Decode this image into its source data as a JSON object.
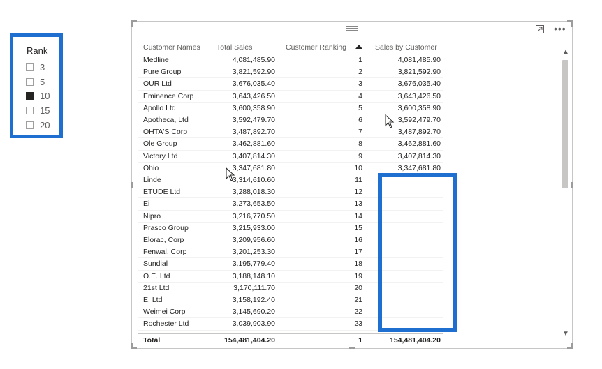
{
  "slicer": {
    "title": "Rank",
    "items": [
      {
        "label": "3",
        "checked": false
      },
      {
        "label": "5",
        "checked": false
      },
      {
        "label": "10",
        "checked": true
      },
      {
        "label": "15",
        "checked": false
      },
      {
        "label": "20",
        "checked": false
      }
    ]
  },
  "table": {
    "headers": {
      "customer_names": "Customer Names",
      "total_sales": "Total Sales",
      "customer_ranking": "Customer Ranking",
      "sales_by_customer": "Sales by Customer"
    },
    "rows": [
      {
        "name": "Medline",
        "sales": "4,081,485.90",
        "rank": "1",
        "sbc": "4,081,485.90"
      },
      {
        "name": "Pure Group",
        "sales": "3,821,592.90",
        "rank": "2",
        "sbc": "3,821,592.90"
      },
      {
        "name": "OUR Ltd",
        "sales": "3,676,035.40",
        "rank": "3",
        "sbc": "3,676,035.40"
      },
      {
        "name": "Eminence Corp",
        "sales": "3,643,426.50",
        "rank": "4",
        "sbc": "3,643,426.50"
      },
      {
        "name": "Apollo Ltd",
        "sales": "3,600,358.90",
        "rank": "5",
        "sbc": "3,600,358.90"
      },
      {
        "name": "Apotheca, Ltd",
        "sales": "3,592,479.70",
        "rank": "6",
        "sbc": "3,592,479.70"
      },
      {
        "name": "OHTA'S Corp",
        "sales": "3,487,892.70",
        "rank": "7",
        "sbc": "3,487,892.70"
      },
      {
        "name": "Ole Group",
        "sales": "3,462,881.60",
        "rank": "8",
        "sbc": "3,462,881.60"
      },
      {
        "name": "Victory Ltd",
        "sales": "3,407,814.30",
        "rank": "9",
        "sbc": "3,407,814.30"
      },
      {
        "name": "Ohio",
        "sales": "3,347,681.80",
        "rank": "10",
        "sbc": "3,347,681.80"
      },
      {
        "name": "Linde",
        "sales": "3,314,610.60",
        "rank": "11",
        "sbc": ""
      },
      {
        "name": "ETUDE Ltd",
        "sales": "3,288,018.30",
        "rank": "12",
        "sbc": ""
      },
      {
        "name": "Ei",
        "sales": "3,273,653.50",
        "rank": "13",
        "sbc": ""
      },
      {
        "name": "Nipro",
        "sales": "3,216,770.50",
        "rank": "14",
        "sbc": ""
      },
      {
        "name": "Prasco Group",
        "sales": "3,215,933.00",
        "rank": "15",
        "sbc": ""
      },
      {
        "name": "Elorac, Corp",
        "sales": "3,209,956.60",
        "rank": "16",
        "sbc": ""
      },
      {
        "name": "Fenwal, Corp",
        "sales": "3,201,253.30",
        "rank": "17",
        "sbc": ""
      },
      {
        "name": "Sundial",
        "sales": "3,195,779.40",
        "rank": "18",
        "sbc": ""
      },
      {
        "name": "O.E. Ltd",
        "sales": "3,188,148.10",
        "rank": "19",
        "sbc": ""
      },
      {
        "name": "21st Ltd",
        "sales": "3,170,111.70",
        "rank": "20",
        "sbc": ""
      },
      {
        "name": "E. Ltd",
        "sales": "3,158,192.40",
        "rank": "21",
        "sbc": ""
      },
      {
        "name": "Weimei Corp",
        "sales": "3,145,690.20",
        "rank": "22",
        "sbc": ""
      },
      {
        "name": "Rochester Ltd",
        "sales": "3,039,903.90",
        "rank": "23",
        "sbc": ""
      }
    ],
    "total": {
      "label": "Total",
      "sales": "154,481,404.20",
      "rank": "1",
      "sbc": "154,481,404.20"
    }
  },
  "icons": {
    "more": "•••",
    "scroll_up": "▲",
    "scroll_down": "▼"
  },
  "colors": {
    "highlight": "#1f6fd1",
    "checked": "#252423"
  }
}
